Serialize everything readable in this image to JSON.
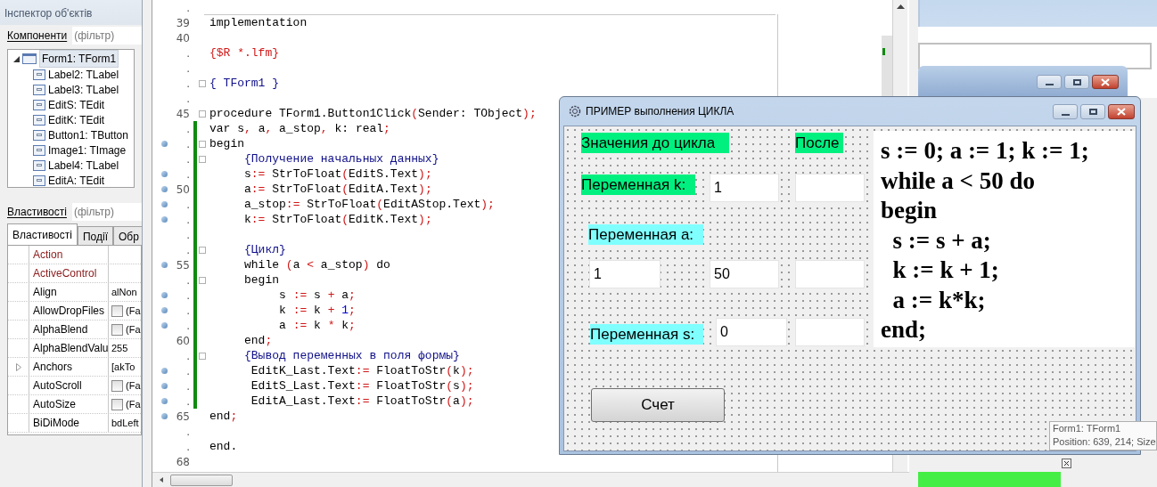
{
  "inspector": {
    "title": "Інспектор об'єктів",
    "components_label": "Компоненти",
    "components_filter": {
      "placeholder": "(фільтр)"
    },
    "tree": [
      {
        "label": "Form1: TForm1",
        "expanded": true,
        "selected": true,
        "children": [
          {
            "label": "Label2: TLabel",
            "selected": false
          },
          {
            "label": "Label3: TLabel",
            "selected": false
          },
          {
            "label": "EditS: TEdit",
            "selected": false
          },
          {
            "label": "EditK: TEdit",
            "selected": false
          },
          {
            "label": "Button1: TButton",
            "selected": false
          },
          {
            "label": "Image1: TImage",
            "selected": false
          },
          {
            "label": "Label4: TLabel",
            "selected": false
          },
          {
            "label": "EditA: TEdit",
            "selected": false
          }
        ]
      }
    ],
    "properties_label": "Властивості",
    "properties_filter": {
      "placeholder": "(фільтр)"
    },
    "tabs": [
      {
        "label": "Властивості",
        "selected": true
      },
      {
        "label": "Події",
        "selected": false
      },
      {
        "label": "Обр",
        "selected": false
      }
    ],
    "properties": [
      {
        "name": "Action",
        "reference": true
      },
      {
        "name": "ActiveControl",
        "reference": true
      },
      {
        "name": "Align",
        "value": "alNon"
      },
      {
        "name": "AllowDropFiles",
        "checked": false,
        "value": "(Fa"
      },
      {
        "name": "AlphaBlend",
        "checked": false,
        "value": "(Fa"
      },
      {
        "name": "AlphaBlendValu",
        "value": "255"
      },
      {
        "name": "Anchors",
        "expandable": true,
        "value": "[akTo"
      },
      {
        "name": "AutoScroll",
        "checked": false,
        "value": "(Fa"
      },
      {
        "name": "AutoSize",
        "checked": false,
        "value": "(Fa"
      },
      {
        "name": "BiDiMode",
        "value": "bdLeft"
      }
    ]
  },
  "editor": {
    "lines": [
      {
        "number": "."
      },
      {
        "number": "39",
        "tokens": [
          {
            "text": "implementation",
            "kind": "plain"
          }
        ]
      },
      {
        "number": "40"
      },
      {
        "number": ".",
        "tokens": [
          {
            "text": "{$R *.lfm}",
            "kind": "directive"
          }
        ]
      },
      {
        "number": "."
      },
      {
        "number": ".",
        "fold": true,
        "tokens": [
          {
            "text": "{ TForm1 }",
            "kind": "comment"
          }
        ]
      },
      {
        "number": "."
      },
      {
        "number": "45",
        "fold": true,
        "tokens": [
          {
            "text": "procedure TForm1.Button1Click",
            "kind": "plain"
          },
          {
            "text": "(",
            "kind": "symbol"
          },
          {
            "text": "Sender: TObject",
            "kind": "plain"
          },
          {
            "text": ");",
            "kind": "symbol"
          }
        ]
      },
      {
        "number": ".",
        "changed": true,
        "tokens": [
          {
            "text": "var s",
            "kind": "plain"
          },
          {
            "text": ",",
            "kind": "symbol"
          },
          {
            "text": " a",
            "kind": "plain"
          },
          {
            "text": ",",
            "kind": "symbol"
          },
          {
            "text": " a_stop",
            "kind": "plain"
          },
          {
            "text": ",",
            "kind": "symbol"
          },
          {
            "text": " k: real",
            "kind": "plain"
          },
          {
            "text": ";",
            "kind": "symbol"
          }
        ]
      },
      {
        "number": ".",
        "executable": true,
        "fold": true,
        "changed": true,
        "tokens": [
          {
            "text": "begin",
            "kind": "plain"
          }
        ]
      },
      {
        "number": ".",
        "fold": true,
        "changed": true,
        "tokens": [
          {
            "text": "     {Получение начальных данных}",
            "kind": "comment"
          }
        ]
      },
      {
        "number": ".",
        "executable": true,
        "changed": true,
        "tokens": [
          {
            "text": "     s",
            "kind": "plain"
          },
          {
            "text": ":=",
            "kind": "symbol"
          },
          {
            "text": " StrToFloat",
            "kind": "plain"
          },
          {
            "text": "(",
            "kind": "symbol"
          },
          {
            "text": "EditS.Text",
            "kind": "plain"
          },
          {
            "text": ");",
            "kind": "symbol"
          }
        ]
      },
      {
        "number": "50",
        "executable": true,
        "changed": true,
        "tokens": [
          {
            "text": "     a",
            "kind": "plain"
          },
          {
            "text": ":=",
            "kind": "symbol"
          },
          {
            "text": " StrToFloat",
            "kind": "plain"
          },
          {
            "text": "(",
            "kind": "symbol"
          },
          {
            "text": "EditA.Text",
            "kind": "plain"
          },
          {
            "text": ");",
            "kind": "symbol"
          }
        ]
      },
      {
        "number": ".",
        "executable": true,
        "changed": true,
        "tokens": [
          {
            "text": "     a_stop",
            "kind": "plain"
          },
          {
            "text": ":=",
            "kind": "symbol"
          },
          {
            "text": " StrToFloat",
            "kind": "plain"
          },
          {
            "text": "(",
            "kind": "symbol"
          },
          {
            "text": "EditAStop.Text",
            "kind": "plain"
          },
          {
            "text": ");",
            "kind": "symbol"
          }
        ]
      },
      {
        "number": ".",
        "executable": true,
        "changed": true,
        "tokens": [
          {
            "text": "     k",
            "kind": "plain"
          },
          {
            "text": ":=",
            "kind": "symbol"
          },
          {
            "text": " StrToFloat",
            "kind": "plain"
          },
          {
            "text": "(",
            "kind": "symbol"
          },
          {
            "text": "EditK.Text",
            "kind": "plain"
          },
          {
            "text": ");",
            "kind": "symbol"
          }
        ]
      },
      {
        "number": ".",
        "changed": true
      },
      {
        "number": ".",
        "fold": true,
        "changed": true,
        "tokens": [
          {
            "text": "     {Цикл}",
            "kind": "comment"
          }
        ]
      },
      {
        "number": "55",
        "executable": true,
        "changed": true,
        "tokens": [
          {
            "text": "     while ",
            "kind": "plain"
          },
          {
            "text": "(",
            "kind": "symbol"
          },
          {
            "text": "a ",
            "kind": "plain"
          },
          {
            "text": "<",
            "kind": "symbol"
          },
          {
            "text": " a_stop",
            "kind": "plain"
          },
          {
            "text": ")",
            "kind": "symbol"
          },
          {
            "text": " do",
            "kind": "plain"
          }
        ]
      },
      {
        "number": ".",
        "fold": true,
        "changed": true,
        "tokens": [
          {
            "text": "     begin",
            "kind": "plain"
          }
        ]
      },
      {
        "number": ".",
        "executable": true,
        "changed": true,
        "tokens": [
          {
            "text": "          s ",
            "kind": "plain"
          },
          {
            "text": ":=",
            "kind": "symbol"
          },
          {
            "text": " s ",
            "kind": "plain"
          },
          {
            "text": "+",
            "kind": "symbol"
          },
          {
            "text": " a",
            "kind": "plain"
          },
          {
            "text": ";",
            "kind": "symbol"
          }
        ]
      },
      {
        "number": ".",
        "executable": true,
        "changed": true,
        "tokens": [
          {
            "text": "          k ",
            "kind": "plain"
          },
          {
            "text": ":=",
            "kind": "symbol"
          },
          {
            "text": " k ",
            "kind": "plain"
          },
          {
            "text": "+",
            "kind": "symbol"
          },
          {
            "text": " 1",
            "kind": "number"
          },
          {
            "text": ";",
            "kind": "symbol"
          }
        ]
      },
      {
        "number": ".",
        "executable": true,
        "changed": true,
        "tokens": [
          {
            "text": "          a ",
            "kind": "plain"
          },
          {
            "text": ":=",
            "kind": "symbol"
          },
          {
            "text": " k ",
            "kind": "plain"
          },
          {
            "text": "*",
            "kind": "symbol"
          },
          {
            "text": " k",
            "kind": "plain"
          },
          {
            "text": ";",
            "kind": "symbol"
          }
        ]
      },
      {
        "number": "60",
        "changed": true,
        "tokens": [
          {
            "text": "     end",
            "kind": "plain"
          },
          {
            "text": ";",
            "kind": "symbol"
          }
        ]
      },
      {
        "number": ".",
        "fold": true,
        "changed": true,
        "tokens": [
          {
            "text": "     {Вывод переменных в поля формы}",
            "kind": "comment"
          }
        ]
      },
      {
        "number": ".",
        "executable": true,
        "changed": true,
        "tokens": [
          {
            "text": "      EditK_Last.Text",
            "kind": "plain"
          },
          {
            "text": ":=",
            "kind": "symbol"
          },
          {
            "text": " FloatToStr",
            "kind": "plain"
          },
          {
            "text": "(",
            "kind": "symbol"
          },
          {
            "text": "k",
            "kind": "plain"
          },
          {
            "text": ");",
            "kind": "symbol"
          }
        ]
      },
      {
        "number": ".",
        "executable": true,
        "changed": true,
        "tokens": [
          {
            "text": "      EditS_Last.Text",
            "kind": "plain"
          },
          {
            "text": ":=",
            "kind": "symbol"
          },
          {
            "text": " FloatToStr",
            "kind": "plain"
          },
          {
            "text": "(",
            "kind": "symbol"
          },
          {
            "text": "s",
            "kind": "plain"
          },
          {
            "text": ");",
            "kind": "symbol"
          }
        ]
      },
      {
        "number": ".",
        "executable": true,
        "changed": true,
        "tokens": [
          {
            "text": "      EditA_Last.Text",
            "kind": "plain"
          },
          {
            "text": ":=",
            "kind": "symbol"
          },
          {
            "text": " FloatToStr",
            "kind": "plain"
          },
          {
            "text": "(",
            "kind": "symbol"
          },
          {
            "text": "a",
            "kind": "plain"
          },
          {
            "text": ");",
            "kind": "symbol"
          }
        ]
      },
      {
        "number": "65",
        "executable": true,
        "tokens": [
          {
            "text": "end",
            "kind": "plain"
          },
          {
            "text": ";",
            "kind": "symbol"
          }
        ]
      },
      {
        "number": "."
      },
      {
        "number": ".",
        "tokens": [
          {
            "text": "end.",
            "kind": "plain"
          }
        ]
      },
      {
        "number": "68"
      }
    ]
  },
  "form": {
    "title": "ПРИМЕР выполнения ЦИКЛА",
    "labels": [
      {
        "text": "Значения до цикла",
        "color": "#00f080"
      },
      {
        "text": "После",
        "color": "#00f080"
      },
      {
        "text": "Переменная k:",
        "color": "#00f080"
      },
      {
        "text": "Переменная а:",
        "color": "#80ffff"
      },
      {
        "text": "Переменная s:",
        "color": "#80ffff"
      }
    ],
    "edits": [
      {
        "kind": "edit",
        "value": "1"
      },
      {
        "kind": "edit"
      },
      {
        "kind": "edit",
        "value": "1"
      },
      {
        "kind": "edit",
        "value": "50"
      },
      {
        "kind": "edit"
      },
      {
        "kind": "edit",
        "value": "0"
      },
      {
        "kind": "edit"
      }
    ],
    "button": "Счет",
    "image_lines": [
      "s := 0; a := 1; k := 1;",
      "while a < 50 do",
      "begin",
      "  s := s + a;",
      "  k := k + 1;",
      "  a := k*k;",
      "end;"
    ]
  },
  "hint": {
    "lines": [
      "Form1: TForm1",
      "Position: 639, 214; Size"
    ]
  }
}
